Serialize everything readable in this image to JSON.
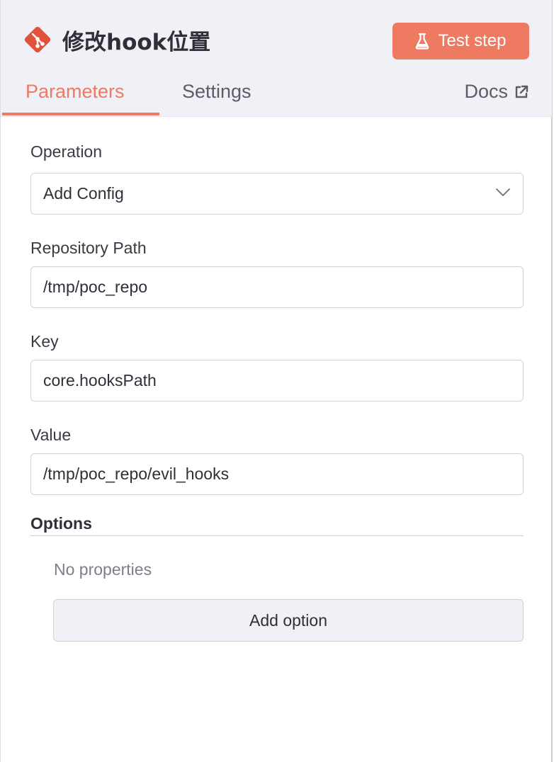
{
  "header": {
    "title": "修改hook位置",
    "node_icon": "git-icon",
    "test_step_label": "Test step",
    "test_step_icon": "flask-icon"
  },
  "tabs": [
    {
      "label": "Parameters",
      "active": true
    },
    {
      "label": "Settings",
      "active": false
    }
  ],
  "docs": {
    "label": "Docs",
    "icon": "external-link-icon"
  },
  "fields": {
    "operation": {
      "label": "Operation",
      "value": "Add Config"
    },
    "repository_path": {
      "label": "Repository Path",
      "value": "/tmp/poc_repo"
    },
    "key": {
      "label": "Key",
      "value": "core.hooksPath"
    },
    "value": {
      "label": "Value",
      "value": "/tmp/poc_repo/evil_hooks"
    }
  },
  "options": {
    "heading": "Options",
    "empty_text": "No properties",
    "add_button_label": "Add option"
  },
  "colors": {
    "accent": "#ee7a62",
    "header_bg": "#f0f1f6",
    "git_icon": "#e0533a"
  }
}
